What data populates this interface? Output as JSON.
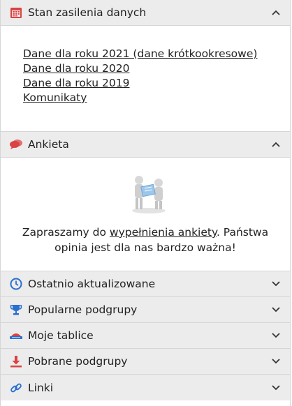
{
  "sections": {
    "data_supply": {
      "title": "Stan zasilenia danych",
      "links": [
        "Dane dla roku 2021 (dane krótkookresowe)",
        "Dane dla roku 2020",
        "Dane dla roku 2019",
        "Komunikaty"
      ]
    },
    "survey": {
      "title": "Ankieta",
      "text_before": "Zapraszamy do ",
      "link": "wypełnienia ankiety",
      "text_after": ". Państwa opinia jest dla nas bardzo ważna!"
    },
    "recent": {
      "title": "Ostatnio aktualizowane"
    },
    "popular": {
      "title": "Popularne podgrupy"
    },
    "boards": {
      "title": "Moje tablice"
    },
    "downloaded": {
      "title": "Pobrane podgrupy"
    },
    "links": {
      "title": "Linki"
    }
  },
  "colors": {
    "header_bg": "#ececec",
    "calendar_icon": "#d94343",
    "chat_icon": "#d94343",
    "clock_icon": "#2a6fcf",
    "trophy_icon": "#2a6fcf",
    "boards_icon": "#d94343",
    "download_icon": "#d94343",
    "link_icon": "#2a6fcf"
  },
  "icons": [
    "calendar-icon",
    "chat-icon",
    "clock-icon",
    "trophy-icon",
    "board-icon",
    "download-icon",
    "link-icon",
    "chevron-up-icon",
    "chevron-down-icon"
  ]
}
